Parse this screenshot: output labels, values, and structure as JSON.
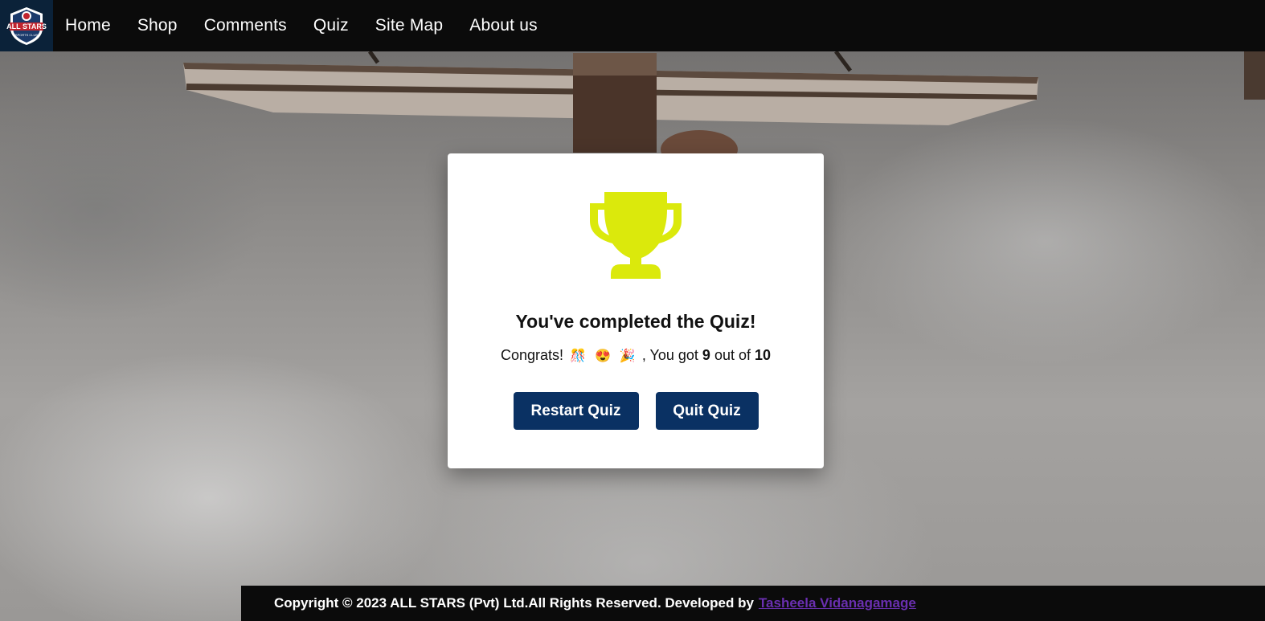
{
  "brand": {
    "logo_text_top": "ALL STARS",
    "logo_text_bottom": "SPORTS CLUB",
    "colors": {
      "navbar": "#0b0b0b",
      "logo_bg": "#0b2239",
      "button": "#0a3163",
      "trophy": "#dbe90c",
      "link": "#6a2fb0"
    }
  },
  "nav": {
    "items": [
      {
        "label": "Home"
      },
      {
        "label": "Shop"
      },
      {
        "label": "Comments"
      },
      {
        "label": "Quiz"
      },
      {
        "label": "Site Map"
      },
      {
        "label": "About us"
      }
    ]
  },
  "result": {
    "icon": "trophy-icon",
    "title": "You've completed the Quiz!",
    "congrats": "Congrats!",
    "emojis": [
      "🎊",
      "😍",
      "🎉"
    ],
    "you_got": ", You got",
    "score": "9",
    "out_of": "out of",
    "total": "10",
    "restart_label": "Restart Quiz",
    "quit_label": "Quit Quiz"
  },
  "footer": {
    "copyright": "Copyright © 2023 ALL STARS (Pvt) Ltd.All Rights Reserved. Developed by",
    "developer": "Tasheela Vidanagamage"
  }
}
